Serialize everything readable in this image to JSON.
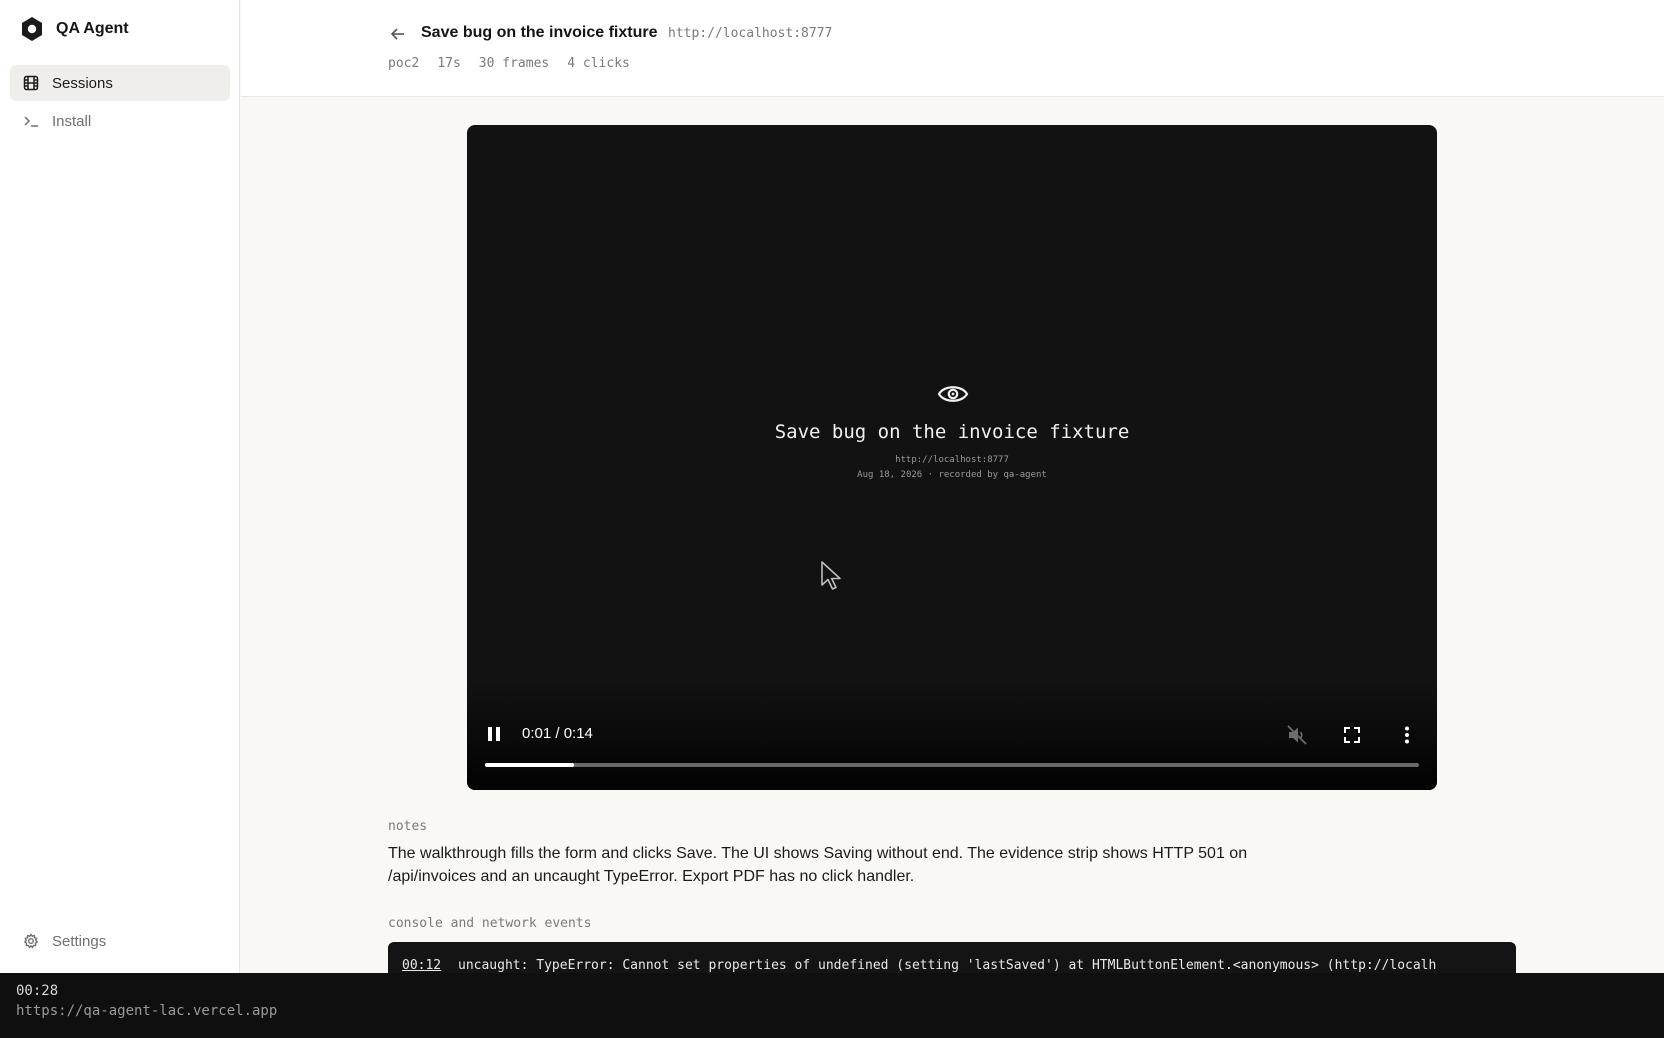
{
  "app": {
    "name": "QA Agent",
    "logo_icon": "aperture-logo-icon"
  },
  "sidebar": {
    "items": [
      {
        "label": "Sessions",
        "icon": "film-icon",
        "active": true
      },
      {
        "label": "Install",
        "icon": "terminal-icon",
        "active": false
      }
    ],
    "footer": {
      "label": "Settings",
      "icon": "gear-icon"
    }
  },
  "header": {
    "back_icon": "arrow-left-icon",
    "title": "Save bug on the invoice fixture",
    "url": "http://localhost:8777",
    "meta": [
      "poc2",
      "17s",
      "30 frames",
      "4 clicks"
    ]
  },
  "video": {
    "overlay_icon": "eye-icon",
    "overlay_title": "Save bug on the invoice fixture",
    "overlay_url": "http://localhost:8777",
    "overlay_subtitle": "Aug 18, 2026 · recorded by qa-agent",
    "cursor_icon": "mouse-pointer-icon",
    "state": "playing",
    "time_display": "0:01 / 0:14",
    "progress": 0.095,
    "controls": {
      "pause_icon": "pause-icon",
      "mute_icon": "volume-muted-icon",
      "fullscreen_icon": "fullscreen-icon",
      "more_icon": "more-vertical-icon"
    }
  },
  "notes": {
    "label": "notes",
    "text": "The walkthrough fills the form and clicks Save. The UI shows Saving without end. The evidence strip shows HTTP 501 on /api/invoices and an uncaught TypeError. Export PDF has no click handler."
  },
  "events": {
    "label": "console and network events",
    "items": [
      {
        "time": "00:12",
        "message": "uncaught: TypeError: Cannot set properties of undefined (setting 'lastSaved') at HTMLButtonElement.<anonymous> (http://localh"
      }
    ]
  },
  "status_bar": {
    "time": "00:28",
    "url": "https://qa-agent-lac.vercel.app"
  },
  "colors": {
    "background": "#f9f8f5",
    "sidebar": "#ffffff",
    "active_nav": "#efeeeb",
    "video_bg": "#121212",
    "console_bg": "#141414",
    "status_bg": "#0f0f0f"
  }
}
